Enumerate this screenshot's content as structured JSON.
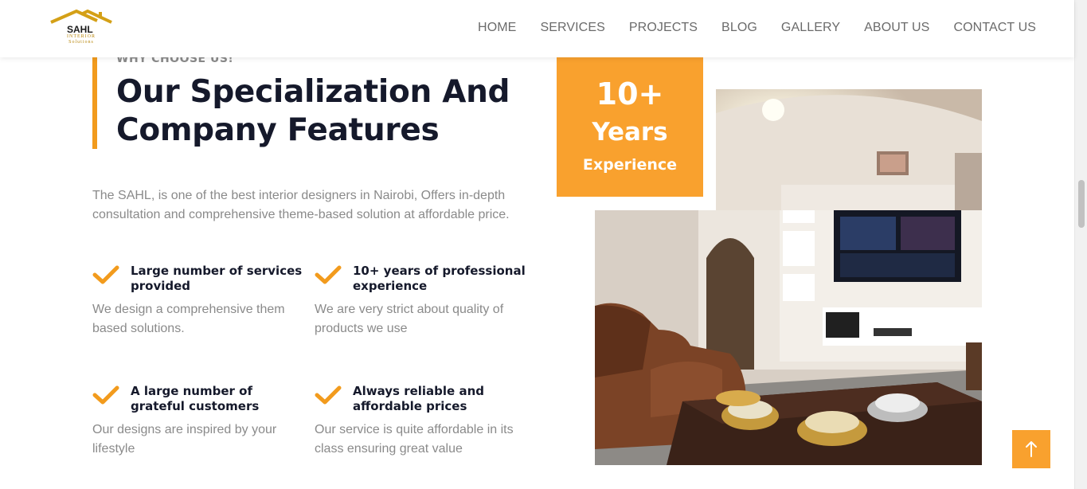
{
  "brand": {
    "name": "SAHL",
    "tagline_line1": "INTERIOR",
    "tagline_line2": "Solutions",
    "accent_color": "#f9a12e",
    "dark_color": "#15192b"
  },
  "nav": {
    "items": [
      {
        "label": "HOME"
      },
      {
        "label": "SERVICES"
      },
      {
        "label": "PROJECTS"
      },
      {
        "label": "BLOG"
      },
      {
        "label": "GALLERY"
      },
      {
        "label": "ABOUT US"
      },
      {
        "label": "CONTACT US"
      }
    ]
  },
  "section": {
    "eyebrow": "WHY CHOOSE US!",
    "title": "Our Specialization And Company Features",
    "intro": "The SAHL, is one of the best interior designers in Nairobi, Offers in-depth consultation and comprehensive theme-based solution at affordable price."
  },
  "features": [
    {
      "title": "Large number of services provided",
      "desc": "We design a comprehensive them based solutions.",
      "icon": "check-icon"
    },
    {
      "title": "10+ years of professional experience",
      "desc": "We are very strict about quality of products we use",
      "icon": "check-icon"
    },
    {
      "title": "A large number of grateful customers",
      "desc": "Our designs are inspired by your lifestyle",
      "icon": "check-icon"
    },
    {
      "title": "Always reliable and affordable prices",
      "desc": "Our service is quite affordable in its class ensuring great value",
      "icon": "check-icon"
    }
  ],
  "badge": {
    "number": "10+",
    "years": "Years",
    "experience": "Experience"
  },
  "back_to_top": {
    "icon": "arrow-up-icon"
  }
}
